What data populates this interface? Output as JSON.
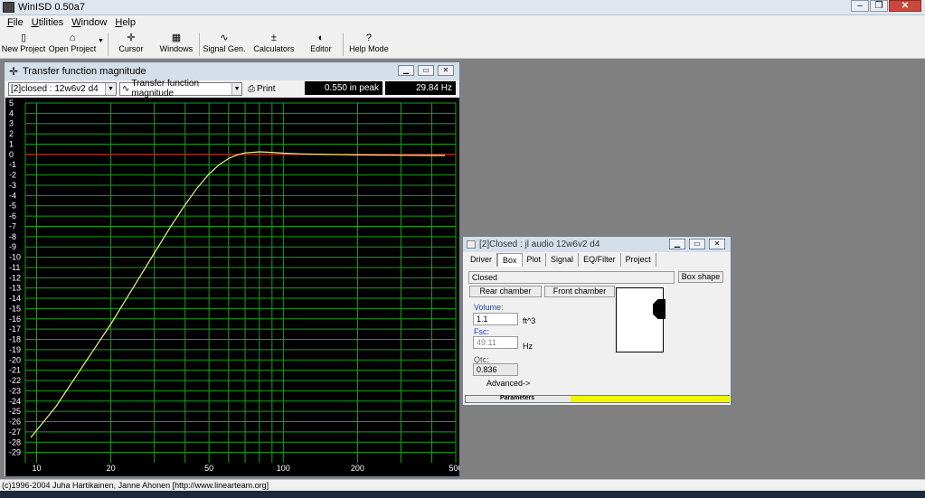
{
  "app": {
    "title": "WinISD 0.50a7"
  },
  "menu": [
    "File",
    "Utilities",
    "Window",
    "Help"
  ],
  "toolbar": [
    {
      "label": "New Project",
      "icon": "new-project-icon",
      "glyph": "▯"
    },
    {
      "label": "Open Project",
      "icon": "open-project-icon",
      "glyph": "⌂",
      "dropdown": true
    },
    {
      "label": "Cursor",
      "icon": "cursor-icon",
      "glyph": "✛"
    },
    {
      "label": "Windows",
      "icon": "windows-icon",
      "glyph": "▦"
    },
    {
      "label": "Signal Gen.",
      "icon": "signal-gen-icon",
      "glyph": "∿"
    },
    {
      "label": "Calculators",
      "icon": "calculators-icon",
      "glyph": "±"
    },
    {
      "label": "Editor",
      "icon": "editor-icon",
      "glyph": "◐"
    },
    {
      "label": "Help Mode",
      "icon": "help-mode-icon",
      "glyph": "?"
    }
  ],
  "transfer_window": {
    "title": "Transfer function magnitude",
    "project_combo": "[2]closed : 12w6v2 d4",
    "graph_combo": "Transfer function magnitude",
    "print_label": "Print",
    "readout_value": "0.550 in peak",
    "readout_freq": "29.84 Hz"
  },
  "chart_data": {
    "type": "line",
    "title": "",
    "xlabel": "",
    "ylabel": "",
    "x_scale": "log",
    "xlim": [
      9,
      500
    ],
    "ylim": [
      -30,
      5
    ],
    "x_ticks": [
      10,
      20,
      50,
      100,
      200,
      500
    ],
    "x_tick_labels": [
      "10",
      "20",
      "50",
      "100",
      "200",
      "500"
    ],
    "y_ticks": [
      5,
      4,
      3,
      2,
      1,
      0,
      -1,
      -2,
      -3,
      -4,
      -5,
      -6,
      -7,
      -8,
      -9,
      -10,
      -11,
      -12,
      -13,
      -14,
      -15,
      -16,
      -17,
      -18,
      -19,
      -20,
      -21,
      -22,
      -23,
      -24,
      -25,
      -26,
      -27,
      -28,
      -29
    ],
    "grid": true,
    "reference_line": {
      "y": 0,
      "color": "#cc2222"
    },
    "series": [
      {
        "color": "#f0f080",
        "x": [
          9.5,
          12,
          15,
          20,
          25,
          30,
          35,
          40,
          45,
          50,
          55,
          60,
          65,
          70,
          80,
          90,
          100,
          120,
          150,
          200,
          300,
          400,
          450
        ],
        "y": [
          -27.5,
          -24.5,
          -21,
          -16.5,
          -12.7,
          -9.6,
          -7.0,
          -4.9,
          -3.2,
          -1.9,
          -1.0,
          -0.4,
          -0.05,
          0.15,
          0.25,
          0.2,
          0.12,
          0.05,
          0.0,
          -0.05,
          -0.08,
          -0.1,
          -0.1
        ]
      }
    ],
    "colors": {
      "background": "#000000",
      "grid": "#1aa01a",
      "axis_text": "#ffffff"
    }
  },
  "box_window": {
    "title": "[2]Closed : jl audio 12w6v2 d4",
    "tabs": [
      "Driver",
      "Box",
      "Plot",
      "Signal",
      "EQ/Filter",
      "Project"
    ],
    "active_tab": "Box",
    "box_type": "Closed",
    "box_shape_button": "Box shape",
    "rear_chamber": "Rear chamber",
    "front_chamber": "Front chamber",
    "volume_label": "Volume:",
    "volume_value": "1.1",
    "volume_unit": "ft^3",
    "fsc_label": "Fsc:",
    "fsc_value": "49.11",
    "fsc_unit": "Hz",
    "qtc_label": "Qtc:",
    "qtc_value": "0.836",
    "advanced": "Advanced->",
    "parameters_label": "Parameters",
    "parameters_color": "#f4f400"
  },
  "status": {
    "text": "(c)1996-2004 Juha Hartikainen, Janne Ahonen [http://www.linearteam.org]"
  }
}
